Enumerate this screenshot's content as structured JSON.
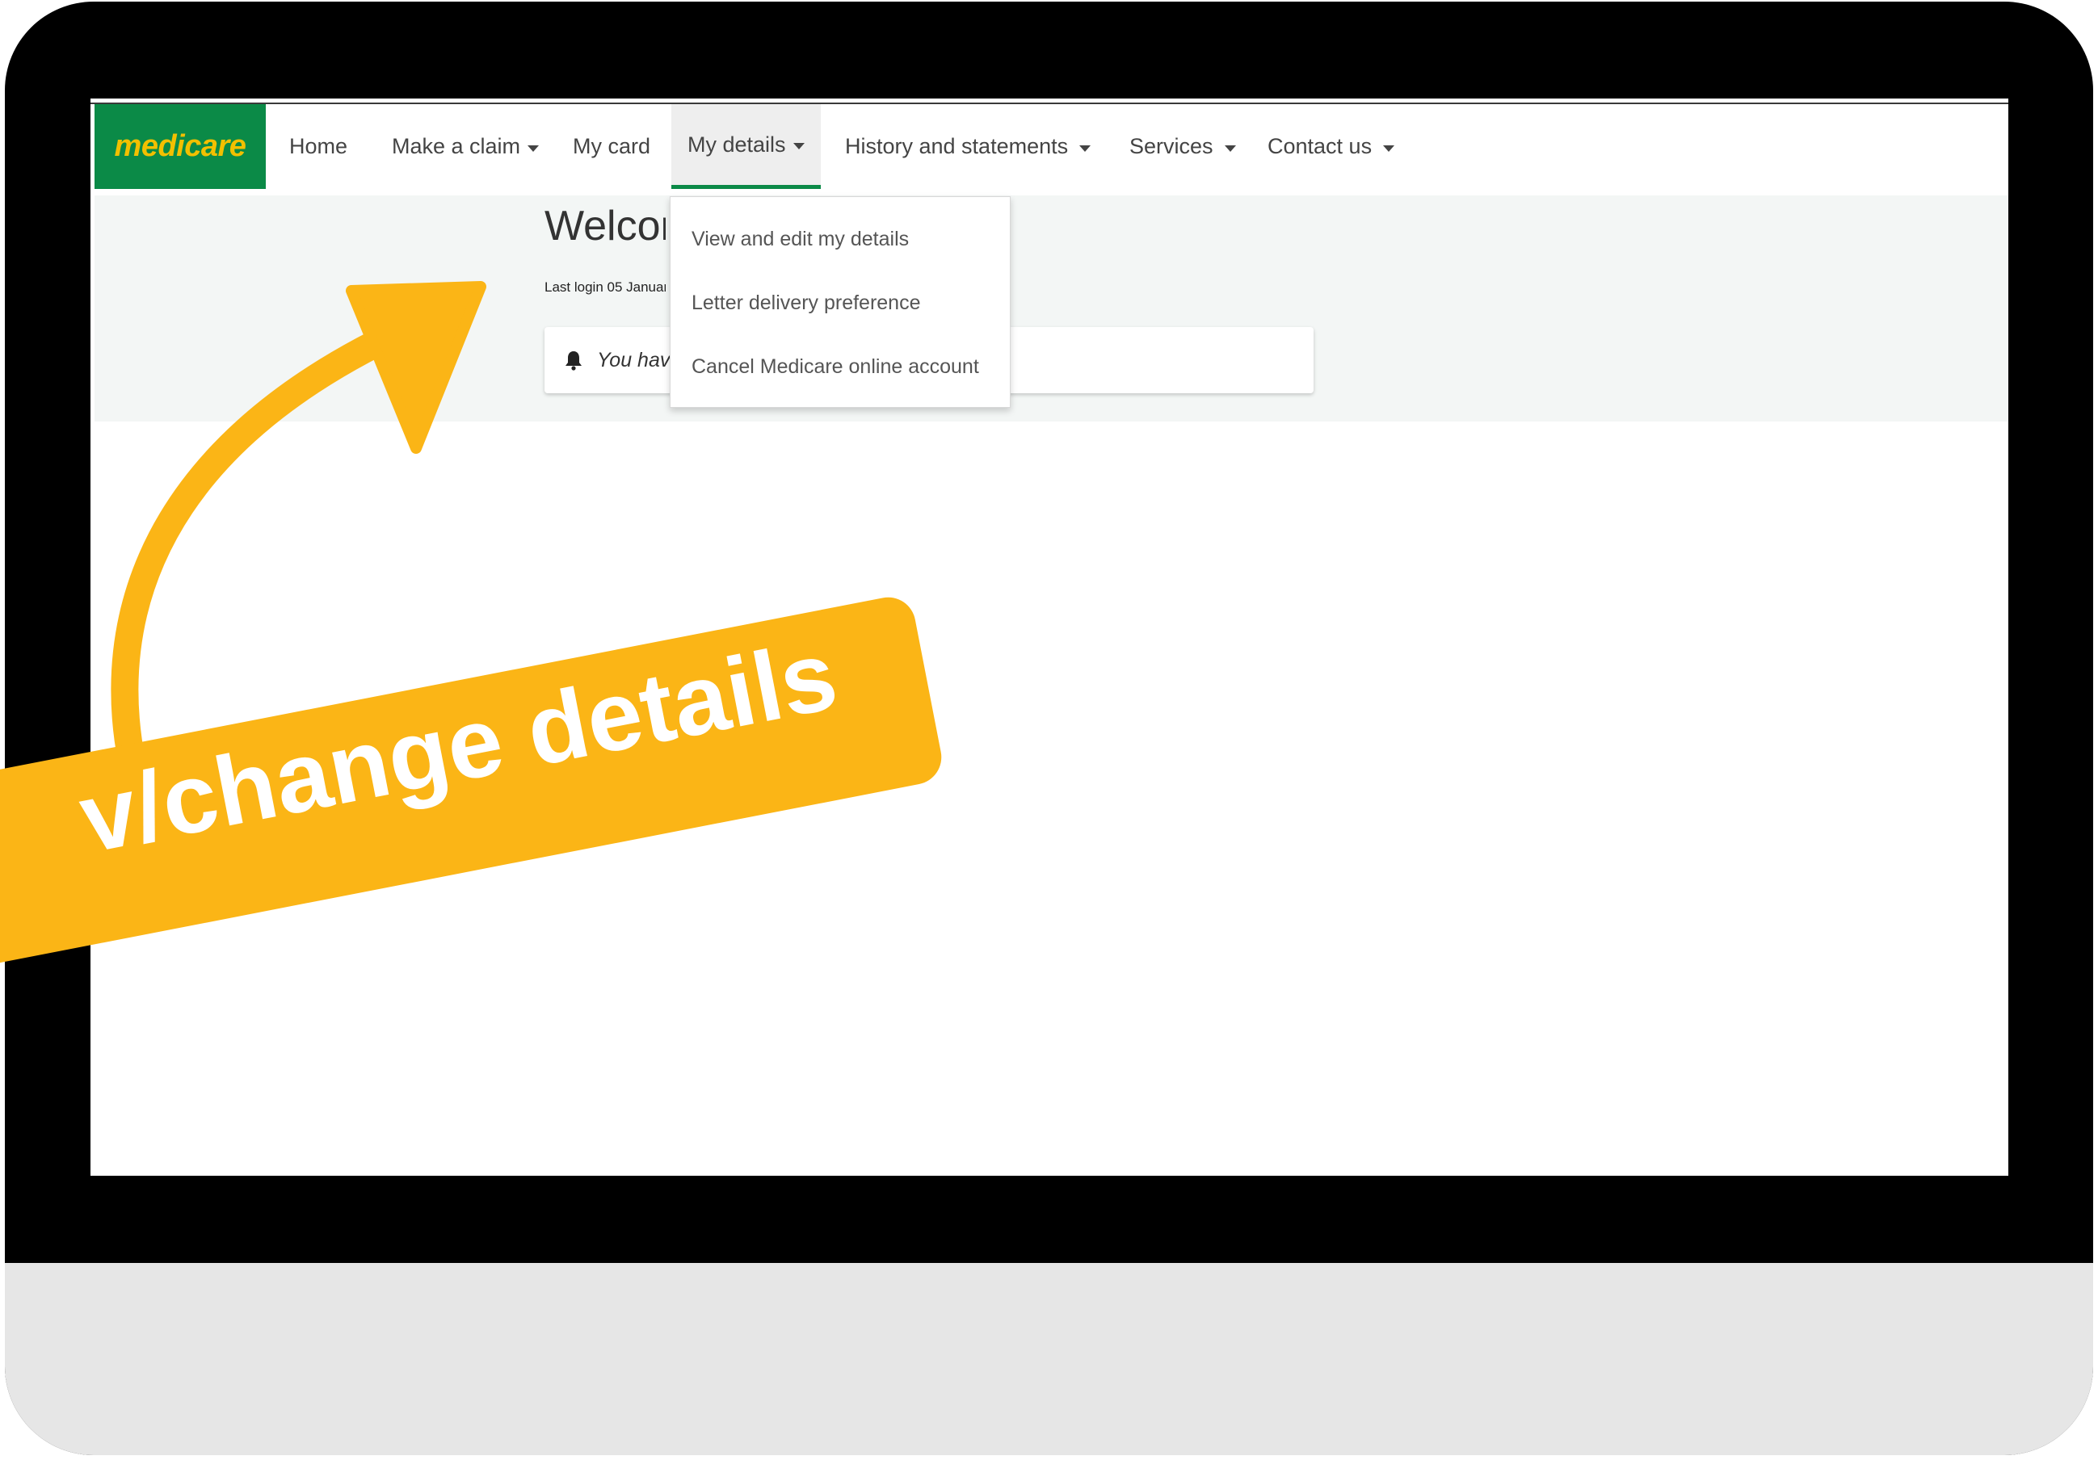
{
  "nav": {
    "logo": "medicare",
    "items": [
      {
        "label": "Home"
      },
      {
        "label": "Make a claim"
      },
      {
        "label": "My card"
      },
      {
        "label": "My details"
      },
      {
        "label": "History and statements"
      },
      {
        "label": "Services"
      },
      {
        "label": "Contact us"
      }
    ]
  },
  "dropdown": {
    "items": [
      {
        "label": "View and edit my details"
      },
      {
        "label": "Letter delivery preference"
      },
      {
        "label": "Cancel Medicare online account"
      }
    ]
  },
  "page": {
    "welcome": "Welcome",
    "last_login": "Last login 05 January",
    "notice": "You have"
  },
  "callout": {
    "text": "v/change details"
  },
  "colors": {
    "brand_green": "#0b8a47",
    "logo_yellow": "#f2c000",
    "callout": "#fbb516"
  }
}
